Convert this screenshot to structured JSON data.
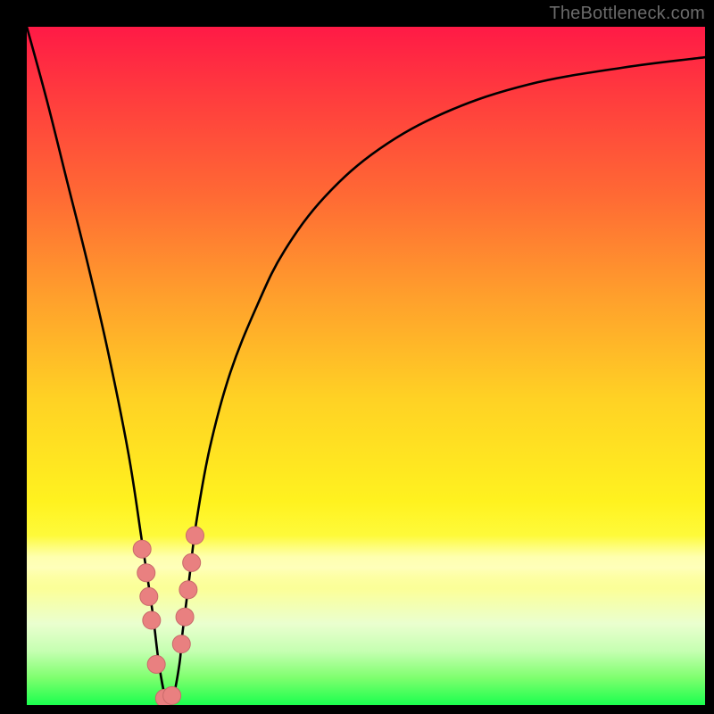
{
  "watermark": "TheBottleneck.com",
  "colors": {
    "frame": "#000000",
    "curve_stroke": "#000000",
    "marker_fill": "#e98080",
    "marker_stroke": "#c86a6a"
  },
  "chart_data": {
    "type": "line",
    "title": "",
    "xlabel": "",
    "ylabel": "",
    "xlim": [
      0,
      100
    ],
    "ylim": [
      0,
      100
    ],
    "grid": false,
    "note": "Values read off pixel positions; no axis ticks or labels are rendered in the source image.",
    "series": [
      {
        "name": "bottleneck-curve",
        "x": [
          0,
          3,
          6,
          9,
          12,
          15,
          17,
          18.5,
          19.5,
          20.5,
          21.5,
          22.5,
          23,
          24,
          25,
          27,
          30,
          34,
          38,
          44,
          52,
          62,
          74,
          88,
          100
        ],
        "y": [
          100,
          89,
          77,
          65,
          52,
          37,
          24,
          14,
          6,
          1,
          1,
          6,
          11,
          19,
          27,
          38,
          49,
          59,
          67,
          75,
          82,
          87.5,
          91.5,
          94,
          95.5
        ]
      }
    ],
    "markers": {
      "name": "highlighted-points",
      "x": [
        17.0,
        17.6,
        18.0,
        18.4,
        19.1,
        20.3,
        21.4,
        22.8,
        23.3,
        23.8,
        24.3,
        24.8
      ],
      "y": [
        23.0,
        19.5,
        16.0,
        12.5,
        6.0,
        1.0,
        1.4,
        9.0,
        13.0,
        17.0,
        21.0,
        25.0
      ]
    }
  }
}
